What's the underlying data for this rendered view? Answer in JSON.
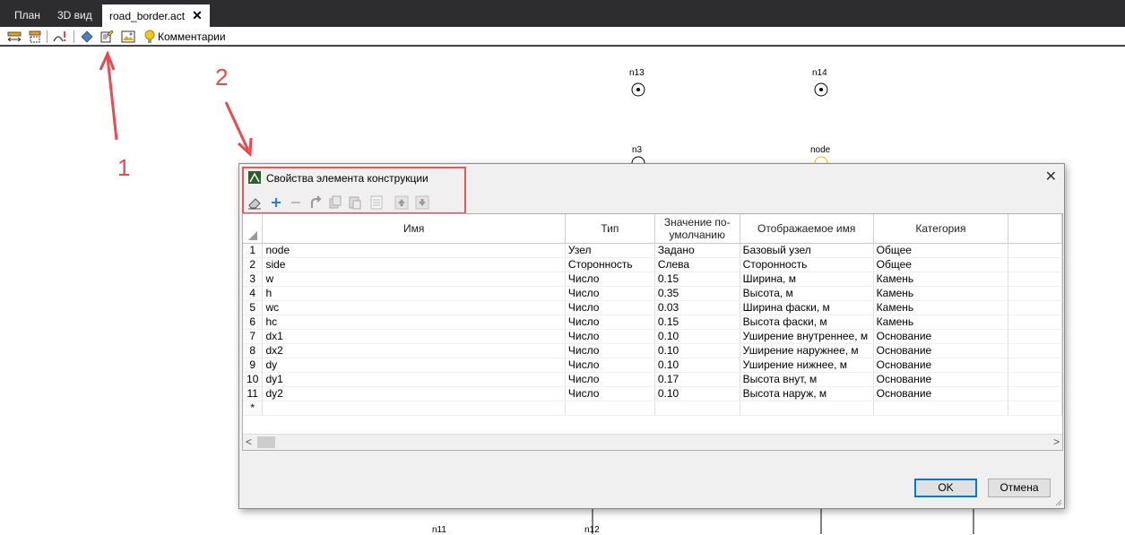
{
  "tabs": [
    {
      "label": "План"
    },
    {
      "label": "3D вид"
    },
    {
      "label": "road_border.act",
      "close": "✕"
    }
  ],
  "toolbar": {
    "comments_label": "Комментарии"
  },
  "canvas": {
    "node_labels": [
      "n13",
      "n14",
      "n3",
      "node",
      "n11",
      "n12"
    ]
  },
  "annotations": {
    "one": "1",
    "two": "2"
  },
  "dialog": {
    "title": "Свойства элемента конструкции",
    "close": "✕",
    "columns": [
      "Имя",
      "Тип",
      "Значение по-умолчанию",
      "Отображаемое имя",
      "Категория"
    ],
    "rows": [
      {
        "num": "1",
        "name": "node",
        "type": "Узел",
        "default": "Задано",
        "display": "Базовый узел",
        "category": "Общее"
      },
      {
        "num": "2",
        "name": "side",
        "type": "Сторонность",
        "default": "Слева",
        "display": "Сторонность",
        "category": "Общее"
      },
      {
        "num": "3",
        "name": "w",
        "type": "Число",
        "default": "0.15",
        "display": "Ширина, м",
        "category": "Камень"
      },
      {
        "num": "4",
        "name": "h",
        "type": "Число",
        "default": "0.35",
        "display": "Высота, м",
        "category": "Камень"
      },
      {
        "num": "5",
        "name": "wc",
        "type": "Число",
        "default": "0.03",
        "display": "Ширина фаски, м",
        "category": "Камень"
      },
      {
        "num": "6",
        "name": "hc",
        "type": "Число",
        "default": "0.15",
        "display": "Высота фаски, м",
        "category": "Камень"
      },
      {
        "num": "7",
        "name": "dx1",
        "type": "Число",
        "default": "0.10",
        "display": "Уширение внутреннее, м",
        "category": "Основание"
      },
      {
        "num": "8",
        "name": "dx2",
        "type": "Число",
        "default": "0.10",
        "display": "Уширение наружнее, м",
        "category": "Основание"
      },
      {
        "num": "9",
        "name": "dy",
        "type": "Число",
        "default": "0.10",
        "display": "Уширение нижнее, м",
        "category": "Основание"
      },
      {
        "num": "10",
        "name": "dy1",
        "type": "Число",
        "default": "0.17",
        "display": "Высота внут, м",
        "category": "Основание"
      },
      {
        "num": "11",
        "name": "dy2",
        "type": "Число",
        "default": "0.10",
        "display": "Высота наруж, м",
        "category": "Основание"
      }
    ],
    "new_row_marker": "*",
    "ok_label": "OK",
    "cancel_label": "Отмена"
  },
  "colors": {
    "annotation": "#e84a4f",
    "tabbar": "#2d2d30",
    "default_button": "#0078d7"
  }
}
